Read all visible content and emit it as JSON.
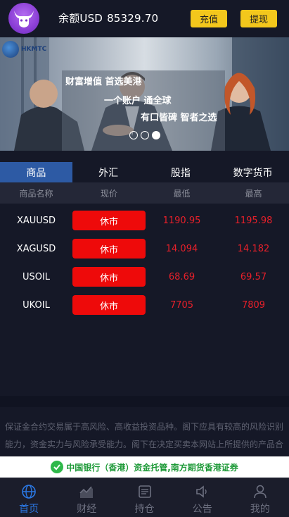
{
  "header": {
    "balance_label": "余额USD",
    "balance_value": "85329.70",
    "deposit_label": "充值",
    "withdraw_label": "提现"
  },
  "banner": {
    "brand": "HKMTC",
    "slogans": [
      "财富增值 首选美港",
      "一个账户 通全球",
      "有口皆碑 智者之选"
    ],
    "slide_count": 3,
    "active_slide": 3
  },
  "tabs": [
    "商品",
    "外汇",
    "股指",
    "数字货币"
  ],
  "active_tab": 0,
  "columns": [
    "商品名称",
    "现价",
    "最低",
    "最高"
  ],
  "rows": [
    {
      "symbol": "XAUUSD",
      "price": "休市",
      "low": "1190.95",
      "high": "1195.98"
    },
    {
      "symbol": "XAGUSD",
      "price": "休市",
      "low": "14.094",
      "high": "14.182"
    },
    {
      "symbol": "USOIL",
      "price": "休市",
      "low": "68.69",
      "high": "69.57"
    },
    {
      "symbol": "UKOIL",
      "price": "休市",
      "low": "7705",
      "high": "7809"
    }
  ],
  "disclaimer": "保证金合约交易属于高风险、高收益投资品种。阁下应具有较高的风险识别能力，资金实力与风险承受能力。阁下在决定买卖本网站上所提供的产品合",
  "custody": "中国银行（香港）资金托管,南方期货香港证券",
  "tabbar": [
    {
      "label": "首页",
      "icon": "globe-icon"
    },
    {
      "label": "财经",
      "icon": "chart-icon"
    },
    {
      "label": "持仓",
      "icon": "portfolio-icon"
    },
    {
      "label": "公告",
      "icon": "speaker-icon"
    },
    {
      "label": "我的",
      "icon": "user-icon"
    }
  ],
  "colors": {
    "accent": "#f3c71c",
    "active_tab": "#2d5aa4",
    "loss_red": "#e8202a",
    "status_btn": "#ee0a0a",
    "nav_active": "#2b78e4"
  }
}
